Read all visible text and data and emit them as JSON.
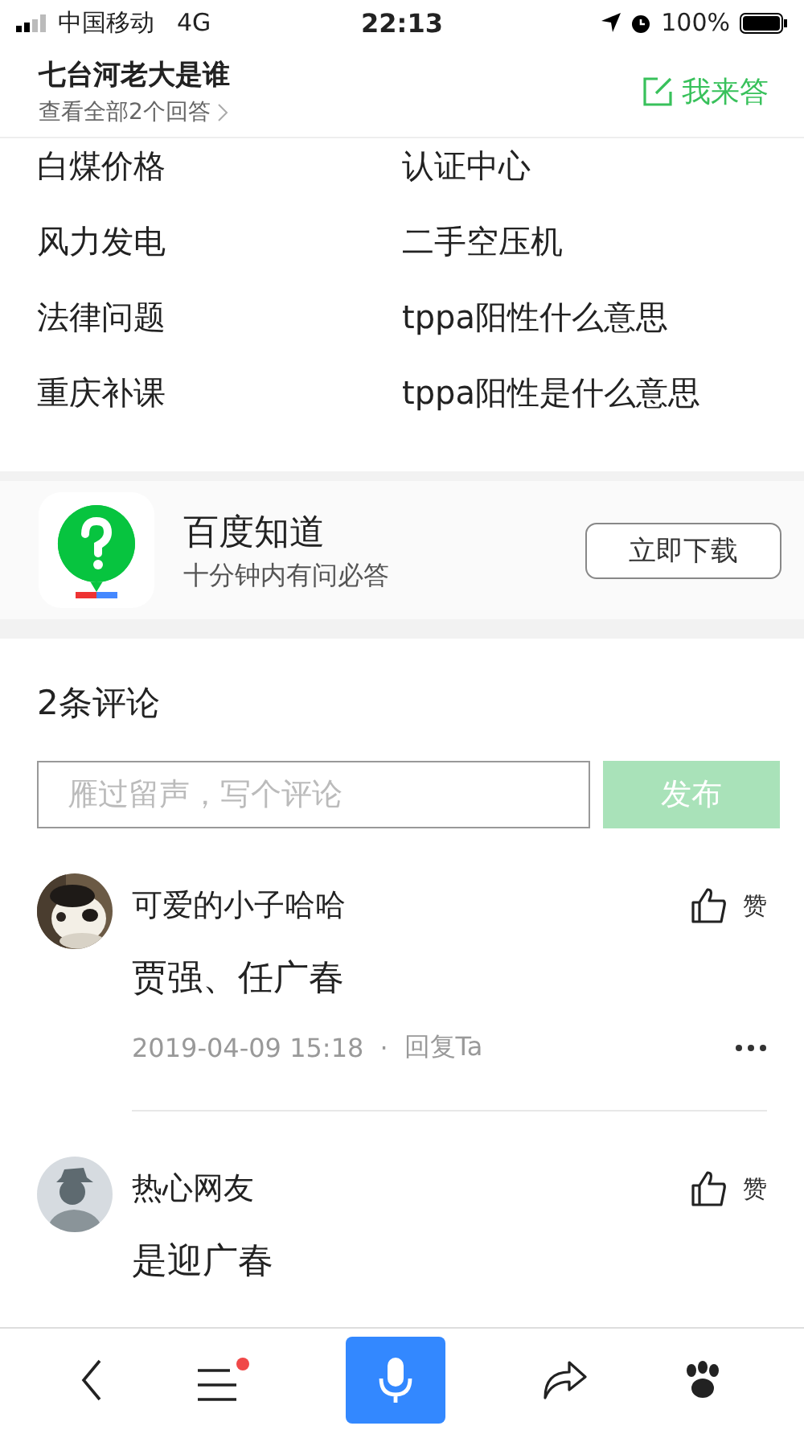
{
  "status_bar": {
    "carrier": "中国移动",
    "network": "4G",
    "time": "22:13",
    "battery": "100%"
  },
  "header": {
    "title": "七台河老大是谁",
    "subtitle": "查看全部2个回答",
    "action": "我来答"
  },
  "related_links": [
    "白煤价格",
    "认证中心",
    "风力发电",
    "二手空压机",
    "法律问题",
    "tppa阳性什么意思",
    "重庆补课",
    "tppa阳性是什么意思"
  ],
  "app_promo": {
    "name": "百度知道",
    "tagline": "十分钟内有问必答",
    "button": "立即下载"
  },
  "comments": {
    "title": "2条评论",
    "input": {
      "placeholder": "雁过留声，写个评论"
    },
    "submit": {
      "label": "发布",
      "disabled": true
    },
    "items": [
      {
        "kind": "picture",
        "name": "可爱的小子哈哈",
        "text": "贾强、任广春",
        "like": "赞",
        "date": "2019-04-09 15:18",
        "separator": "·",
        "reply": "回复Ta"
      },
      {
        "kind": "silhouette",
        "name": "热心网友",
        "text": "是迎广春",
        "like": "赞"
      }
    ]
  },
  "bottom_bar": {
    "menu_badge": true
  }
}
